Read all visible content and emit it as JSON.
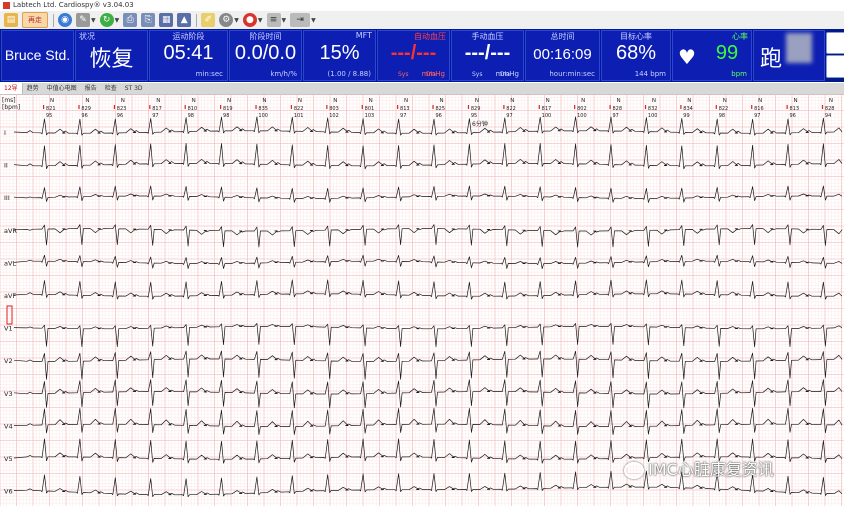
{
  "window": {
    "title": "Labtech Ltd. Cardiospy® v3.04.03"
  },
  "toolbar": {
    "home_label": "再走"
  },
  "panel": {
    "protocol": "Bruce Std.",
    "phase_caption": "状况",
    "phase_value": "恢复",
    "phase_time_caption": "运动阶段",
    "phase_time_value": "05:41",
    "phase_time_unit": "min:sec",
    "speed_caption": "阶段时间",
    "speed_value": "0.0/0.0",
    "speed_unit": "km/h/%",
    "mft_caption": "MFT",
    "mft_value": "15%",
    "mft_sub": "(1.00 / 8.88)",
    "auto_bp_caption": "自动血压",
    "auto_bp_value": "---/---",
    "auto_bp_sys": "Sys",
    "auto_bp_dia": "Dia",
    "auto_bp_unit": "mmHg",
    "manual_bp_caption": "手动血压",
    "manual_bp_value": "---/---",
    "manual_bp_sys": "Sys",
    "manual_bp_dia": "Dia",
    "manual_bp_unit": "mmHg",
    "total_time_caption": "总时间",
    "total_time_value": "00:16:09",
    "total_time_unit": "hour:min:sec",
    "target_hr_caption": "目标心率",
    "target_hr_value": "68%",
    "target_hr_unit": "144 bpm",
    "hr_caption": "心率",
    "hr_value": "99",
    "hr_unit": "bpm",
    "run_label": "跑"
  },
  "tabs": [
    "12导",
    "趋势",
    "中值心电图",
    "报告",
    "检查",
    "ST 3D"
  ],
  "ecg": {
    "header_unit_ms": "[ms]",
    "header_unit_bpm": "[bpm]",
    "beat_labels": [
      "821",
      "829",
      "823",
      "817",
      "810",
      "819",
      "835",
      "822",
      "803",
      "801",
      "813",
      "825",
      "829",
      "822",
      "817",
      "802",
      "828",
      "832",
      "834",
      "822",
      "816",
      "813",
      "828"
    ],
    "beat_hr": [
      "95",
      "96",
      "96",
      "97",
      "98",
      "98",
      "100",
      "101",
      "102",
      "103",
      "97",
      "96",
      "95",
      "97",
      "100",
      "100",
      "97",
      "100",
      "99",
      "98",
      "97",
      "96",
      "94"
    ],
    "event_label": "6分钟",
    "leads": [
      "I",
      "II",
      "III",
      "aVR",
      "aVL",
      "aVF",
      "V1",
      "V2",
      "V3",
      "V4",
      "V5",
      "V6"
    ],
    "grid_color": "#f4b8b8",
    "grid_minor_color": "#fbe3e3",
    "trace_color": "#1a1a1a"
  },
  "watermark": "IMC心脏康复资讯"
}
